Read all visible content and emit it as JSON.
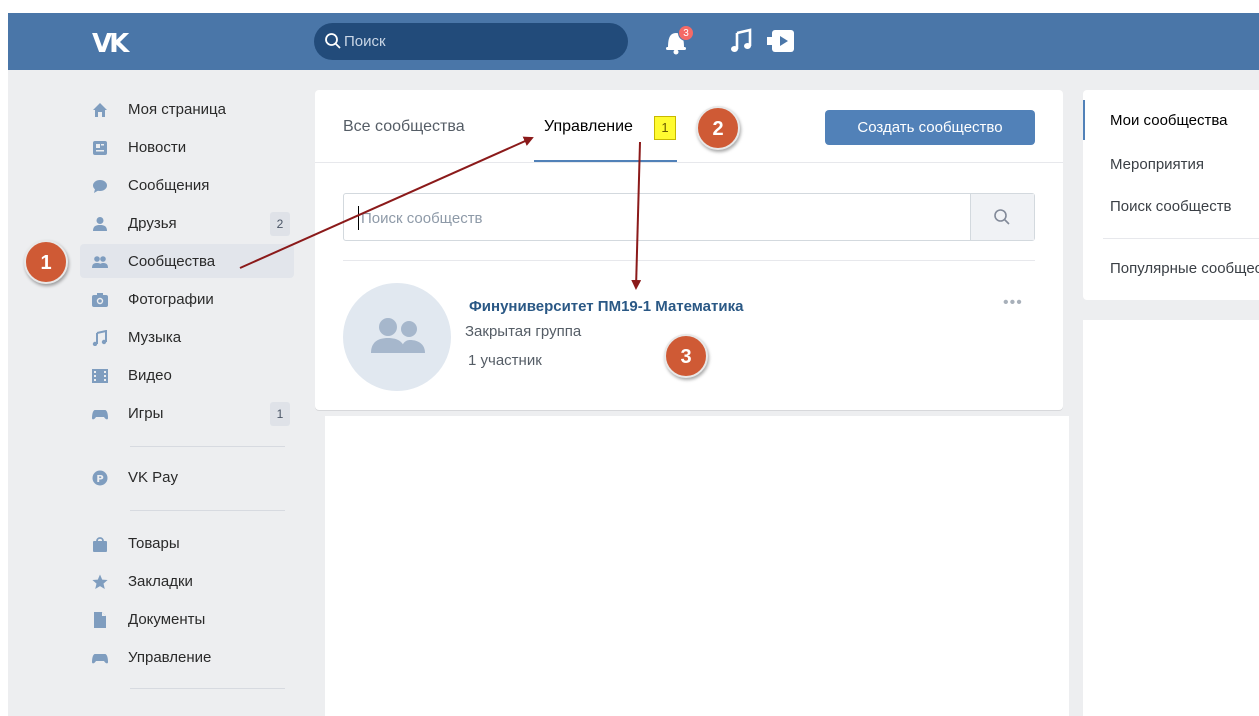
{
  "header": {
    "logo": "VK",
    "search_placeholder": "Поиск",
    "notifications_count": "3",
    "colors": {
      "bar": "#4a76a8",
      "search_bg": "#224b7a",
      "badge": "#f46a66"
    }
  },
  "sidebar": {
    "items": [
      {
        "label": "Моя страница",
        "icon": "home-icon"
      },
      {
        "label": "Новости",
        "icon": "news-icon"
      },
      {
        "label": "Сообщения",
        "icon": "messages-icon"
      },
      {
        "label": "Друзья",
        "icon": "friends-icon",
        "count": "2"
      },
      {
        "label": "Сообщества",
        "icon": "communities-icon",
        "active": true
      },
      {
        "label": "Фотографии",
        "icon": "camera-icon"
      },
      {
        "label": "Музыка",
        "icon": "music-icon"
      },
      {
        "label": "Видео",
        "icon": "video-icon"
      },
      {
        "label": "Игры",
        "icon": "gamepad-icon",
        "count": "1"
      },
      {
        "label": "VK Pay",
        "icon": "vkpay-icon"
      },
      {
        "label": "Товары",
        "icon": "bag-icon"
      },
      {
        "label": "Закладки",
        "icon": "star-icon"
      },
      {
        "label": "Документы",
        "icon": "document-icon"
      },
      {
        "label": "Управление",
        "icon": "gamepad-icon"
      }
    ]
  },
  "main": {
    "tabs": [
      {
        "label": "Все сообщества"
      },
      {
        "label": "Управление",
        "count": "1",
        "active": true
      }
    ],
    "create_button": "Создать сообщество",
    "search_placeholder": "Поиск сообществ",
    "group": {
      "name": "Финуниверситет ПМ19-1 Математика",
      "type": "Закрытая группа",
      "members": "1 участник",
      "menu": "•••"
    }
  },
  "right_menu": {
    "items": [
      {
        "label": "Мои сообщества",
        "active": true
      },
      {
        "label": "Мероприятия"
      },
      {
        "label": "Поиск сообществ"
      },
      {
        "label": "Популярные сообщества"
      }
    ]
  },
  "annotations": {
    "markers": [
      "1",
      "2",
      "3"
    ],
    "colors": {
      "marker": "#cf5a35",
      "arrow": "#8b1a1a",
      "highlight": "#fffb30"
    }
  }
}
